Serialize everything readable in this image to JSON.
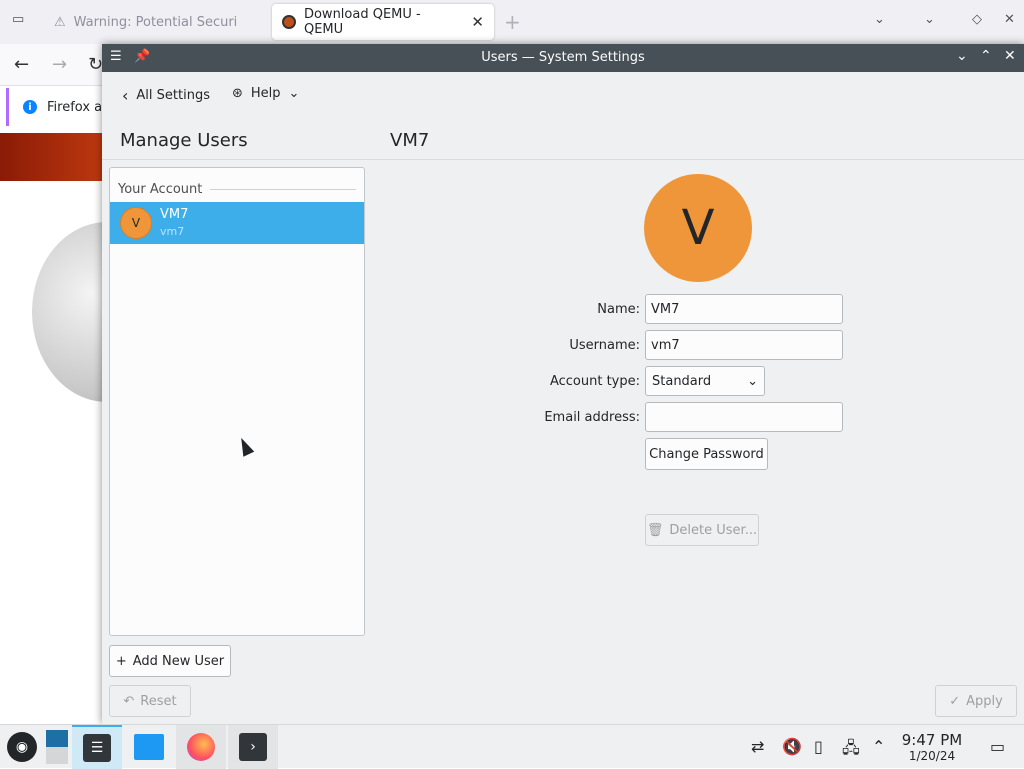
{
  "firefox": {
    "tabs": [
      {
        "label": "Warning: Potential Securi",
        "active": false
      },
      {
        "label": "Download QEMU - QEMU",
        "active": true
      }
    ],
    "notice_text": "Firefox au"
  },
  "window": {
    "title": "Users — System Settings",
    "toolbar": {
      "back_label": "All Settings",
      "help_label": "Help"
    },
    "left_heading": "Manage Users",
    "right_heading": "VM7",
    "list": {
      "section_label": "Your Account",
      "users": [
        {
          "initial": "V",
          "name": "VM7",
          "username": "vm7"
        }
      ]
    },
    "add_user_label": "Add New User",
    "reset_label": "Reset",
    "apply_label": "Apply",
    "details": {
      "avatar_initial": "V",
      "name_label": "Name:",
      "name_value": "VM7",
      "username_label": "Username:",
      "username_value": "vm7",
      "account_type_label": "Account type:",
      "account_type_value": "Standard",
      "email_label": "Email address:",
      "email_value": "",
      "change_password_label": "Change Password",
      "delete_user_label": "Delete User..."
    }
  },
  "taskbar": {
    "time": "9:47 PM",
    "date": "1/20/24"
  },
  "colors": {
    "accent": "#3daee9",
    "avatar": "#f0963a",
    "titlebar": "#475057"
  }
}
